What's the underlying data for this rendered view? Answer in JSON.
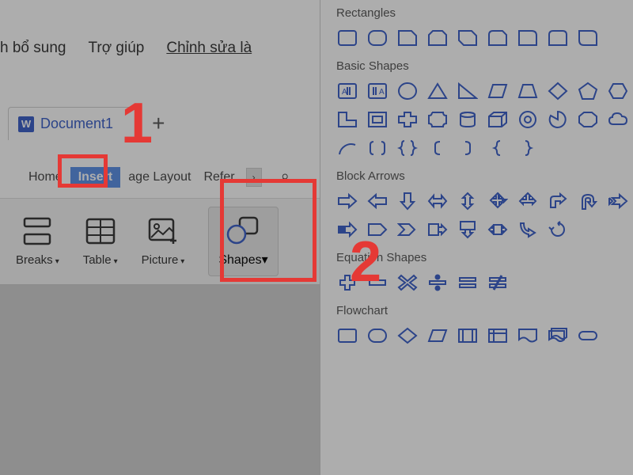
{
  "menu": {
    "addin": "h bổ sung",
    "help": "Trợ giúp",
    "edit": "Chỉnh sửa là"
  },
  "tab": {
    "doc": "Document1",
    "plus": "+",
    "wicon": "W"
  },
  "ribbon": {
    "home": "Home",
    "insert": "Insert",
    "layout": "age Layout",
    "refs": "Refer",
    "scroll": "›",
    "search": "⌕"
  },
  "toolbar": {
    "breaks": "Breaks",
    "table": "Table",
    "picture": "Picture",
    "shapes": "Shapes",
    "drop": "▾"
  },
  "sections": {
    "rect": "Rectangles",
    "basic": "Basic Shapes",
    "arrows": "Block Arrows",
    "eq": "Equation Shapes",
    "flow": "Flowchart"
  },
  "ann": {
    "n1": "1",
    "n2": "2"
  }
}
